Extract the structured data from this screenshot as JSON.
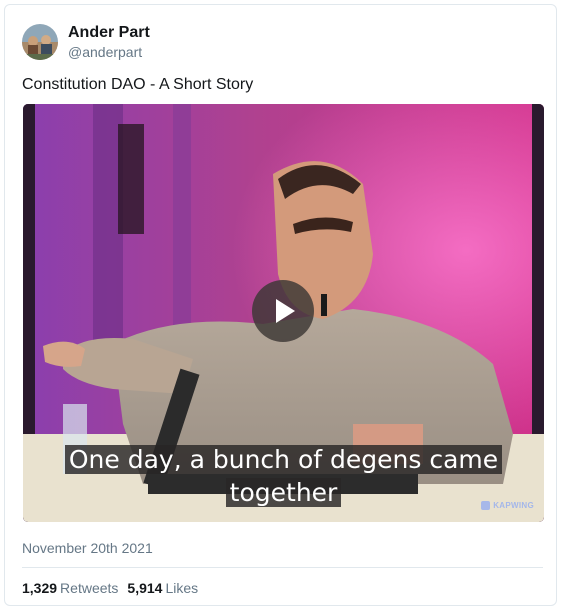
{
  "author": {
    "display_name": "Ander Part",
    "handle": "@anderpart"
  },
  "tweet": {
    "text": "Constitution DAO - A Short Story",
    "timestamp": "November 20th 2021"
  },
  "media": {
    "type": "video",
    "subtitle_line1": "One day, a bunch of degens came",
    "subtitle_line2": "together",
    "watermark": "KAPWING",
    "play_icon": "play-icon"
  },
  "stats": {
    "retweets_count": "1,329",
    "retweets_label": "Retweets",
    "likes_count": "5,914",
    "likes_label": "Likes"
  },
  "colors": {
    "primary_text": "#14171a",
    "secondary_text": "#657786",
    "border": "#e1e8ed"
  }
}
